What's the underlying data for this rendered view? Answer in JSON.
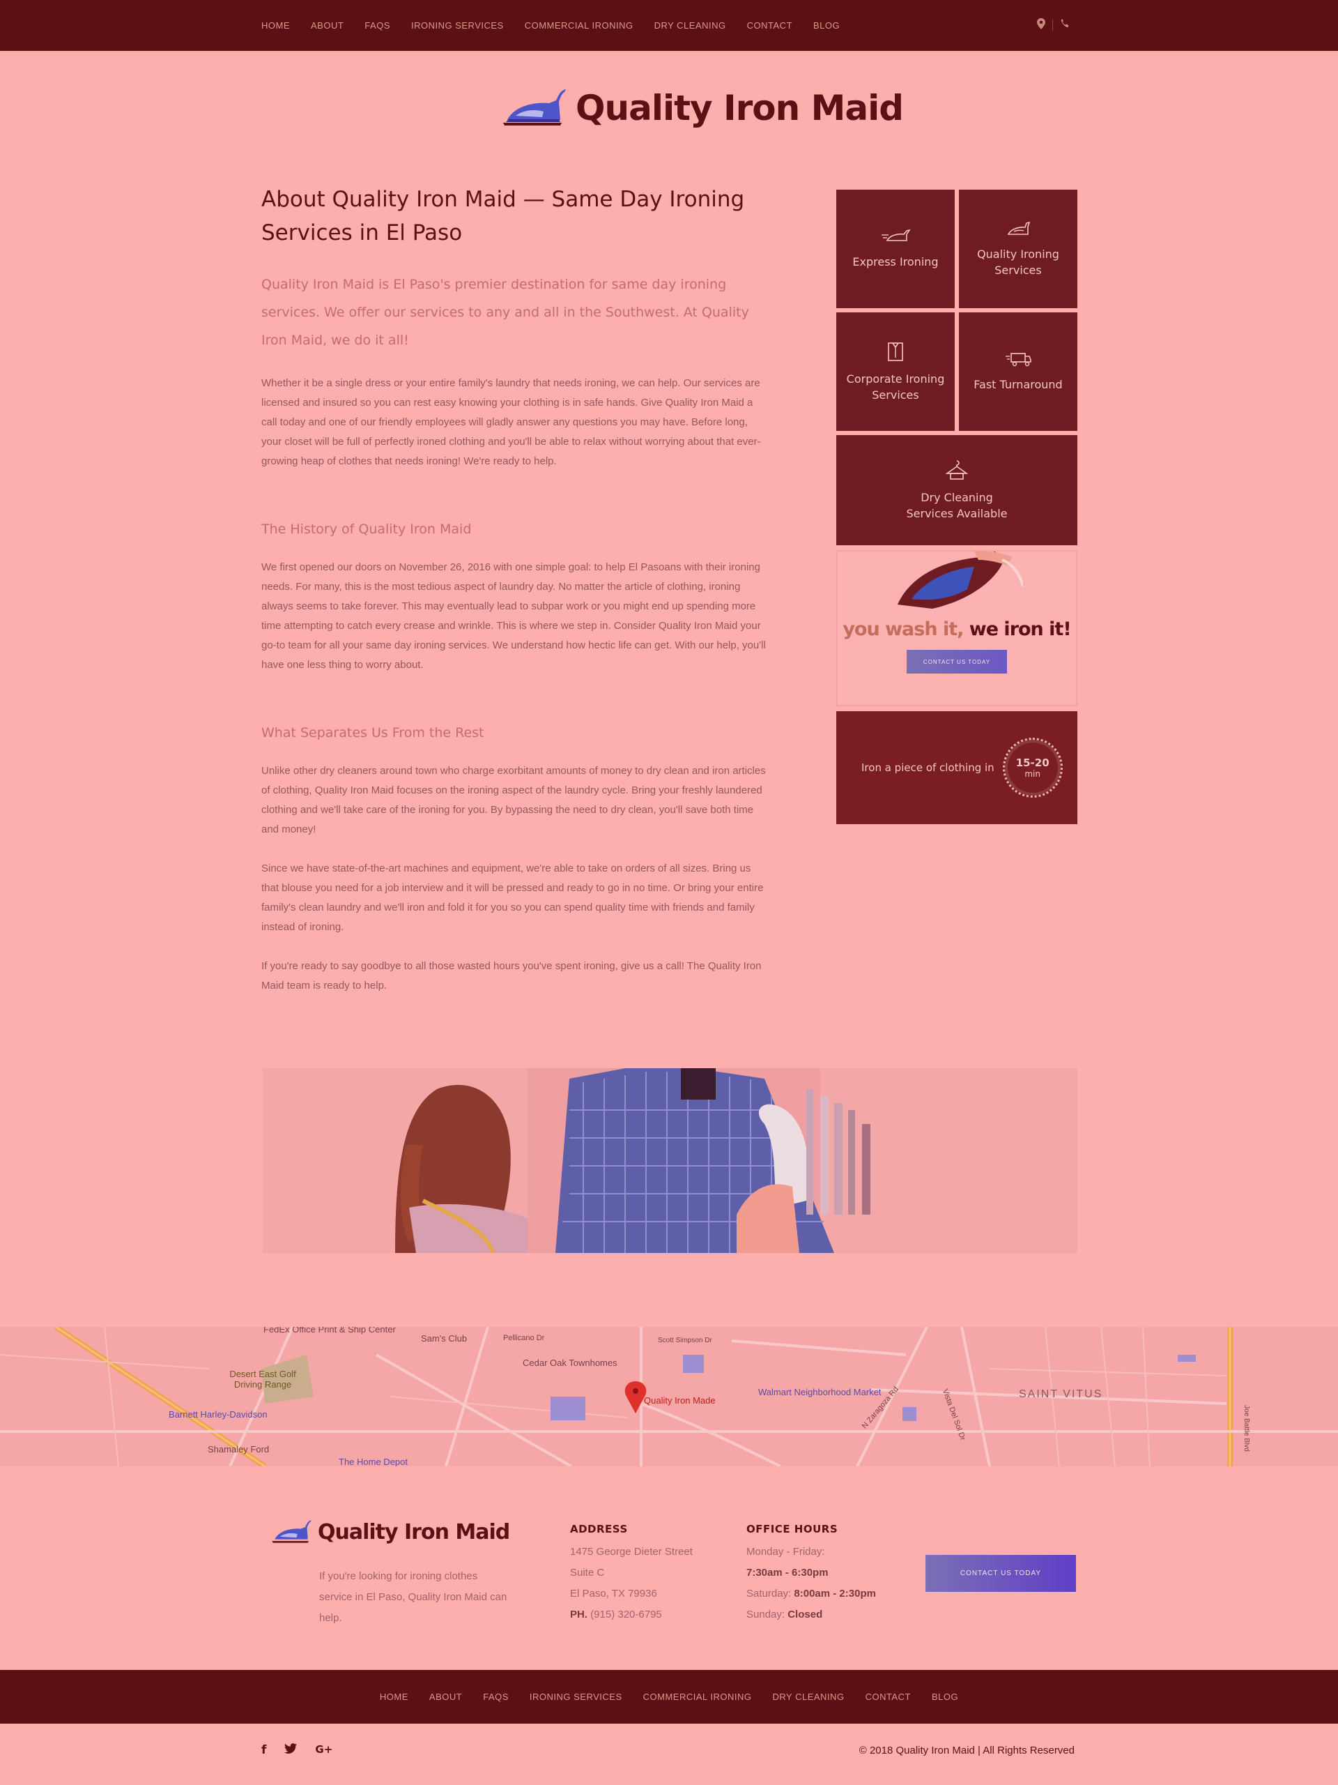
{
  "nav": {
    "items": [
      "HOME",
      "ABOUT",
      "FAQS",
      "IRONING SERVICES",
      "COMMERCIAL IRONING",
      "DRY CLEANING",
      "CONTACT",
      "BLOG"
    ],
    "icons": [
      "map-pin-icon",
      "phone-icon"
    ]
  },
  "brand": {
    "name": "Quality Iron Maid"
  },
  "about": {
    "title": "About Quality Iron Maid — Same Day Ironing Services in El Paso",
    "lead": "Quality Iron Maid is El Paso's premier destination for same day ironing services. We offer our services to any and all in the Southwest. At Quality Iron Maid, we do it all!",
    "p1": "Whether it be a single dress or your entire family's laundry that needs ironing, we can help. Our services are licensed and insured so you can rest easy knowing your clothing is in safe hands. Give Quality Iron Maid a call today and one of our friendly employees will gladly answer any questions you may have. Before long, your closet will be full of perfectly ironed clothing and you'll be able to relax without worrying about that ever-growing heap of clothes that needs ironing! We're ready to help.",
    "h_history": "The History of Quality Iron Maid",
    "p_history": "We first opened our doors on November 26, 2016 with one simple goal: to help El Pasoans with their ironing needs. For many, this is the most tedious aspect of laundry day. No matter the article of clothing, ironing always seems to take forever. This may eventually lead to subpar work or you might end up spending more time attempting to catch every crease and wrinkle. This is where we step in. Consider Quality Iron Maid your go-to team for all your same day ironing services. We understand how hectic life can get. With our help, you'll have one less thing to worry about.",
    "h_separate": "What Separates Us From the Rest",
    "p_sep1": "Unlike other dry cleaners around town who charge exorbitant amounts of money to dry clean and iron articles of clothing, Quality Iron Maid focuses on the ironing aspect of the laundry cycle. Bring your freshly laundered clothing and we'll take care of the ironing for you. By bypassing the need to dry clean, you'll save both time and money!",
    "p_sep2": "Since we have state-of-the-art machines and equipment, we're able to take on orders of all sizes. Bring us that blouse you need for a job interview and it will be pressed and ready to go in no time. Or bring your entire family's clean laundry and we'll iron and fold it for you so you can spend quality time with friends and family instead of ironing.",
    "p_sep3": "If you're ready to say goodbye to all those wasted hours you've spent ironing, give us a call! The Quality Iron Maid team is ready to help."
  },
  "tiles": {
    "express": "Express Ironing",
    "quality": "Quality Ironing Services",
    "corporate": "Corporate Ironing Services",
    "fast": "Fast Turnaround",
    "dry": "Dry Cleaning Services Available"
  },
  "promo": {
    "slogan_a": "you wash it,",
    "slogan_b": "we iron it!",
    "button": "CONTACT US TODAY"
  },
  "timer": {
    "text": "Iron a piece of clothing in",
    "range": "15-20",
    "unit": "min"
  },
  "map": {
    "labels": [
      "FedEx Office Print & Ship Center",
      "Sam's Club",
      "Pellicano Dr",
      "Cedar Oak Townhomes",
      "Desert East Golf Driving Range",
      "Barnett Harley-Davidson",
      "Shamaley Ford",
      "The Home Depot",
      "Quality Iron Made",
      "Walmart Neighborhood Market",
      "SAINT VITUS",
      "N Zaragoza Rd",
      "Vista Del Sol Dr",
      "Scott Simpson Dr",
      "Joe Battle Blvd"
    ]
  },
  "footer": {
    "desc": "If you're looking for ironing clothes service in El Paso, Quality Iron Maid can help.",
    "address_head": "ADDRESS",
    "address1": "1475 George Dieter Street",
    "address2": "Suite C",
    "address3": "El Paso, TX 79936",
    "phone_label": "PH.",
    "phone": "(915) 320-6795",
    "hours_head": "OFFICE HOURS",
    "weekday_label": "Monday - Friday:",
    "weekday_hours": "7:30am - 6:30pm",
    "saturday_label": "Saturday:",
    "saturday_hours": "8:00am - 2:30pm",
    "sunday_label": "Sunday:",
    "sunday_hours": "Closed",
    "button": "CONTACT US TODAY",
    "copyright": "© 2018 Quality Iron Maid  |  All Rights Reserved",
    "social": [
      "facebook-icon",
      "twitter-icon",
      "google-plus-icon"
    ]
  },
  "colors": {
    "accent_dark": "#5c1014",
    "background": "#fcafad",
    "button_gradient_start": "#7b6fb5",
    "button_gradient_end": "#5f3fc6"
  }
}
